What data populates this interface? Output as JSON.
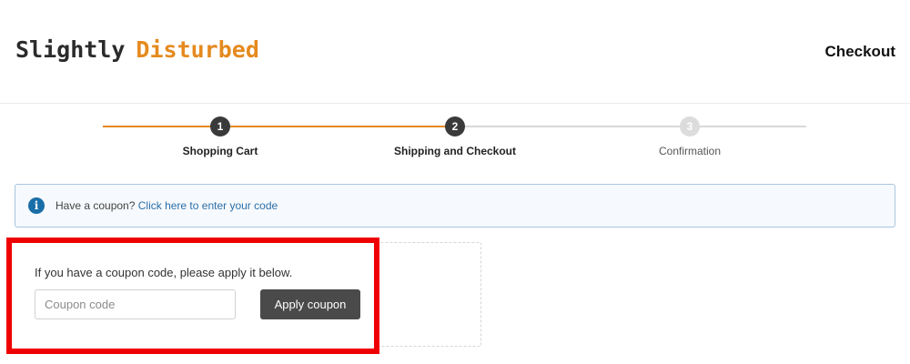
{
  "header": {
    "logo_word1": "Slightly",
    "logo_word2": "Disturbed",
    "title": "Checkout",
    "colors": {
      "logo_dark": "#2b2b2b",
      "logo_accent": "#e58a1f"
    }
  },
  "progress": {
    "steps": [
      {
        "number": "1",
        "label": "Shopping Cart",
        "state": "completed"
      },
      {
        "number": "2",
        "label": "Shipping and Checkout",
        "state": "current"
      },
      {
        "number": "3",
        "label": "Confirmation",
        "state": "upcoming"
      }
    ],
    "colors": {
      "done": "#e58a1f",
      "todo": "#d8d8d8",
      "active_circle": "#3a3a3a"
    }
  },
  "notice": {
    "icon": "info-icon",
    "text": "Have a coupon?",
    "link": "Click here to enter your code"
  },
  "coupon": {
    "prompt": "If you have a coupon code, please apply it below.",
    "input_placeholder": "Coupon code",
    "input_value": "",
    "button_label": "Apply coupon",
    "highlight_color": "#ee0000"
  }
}
